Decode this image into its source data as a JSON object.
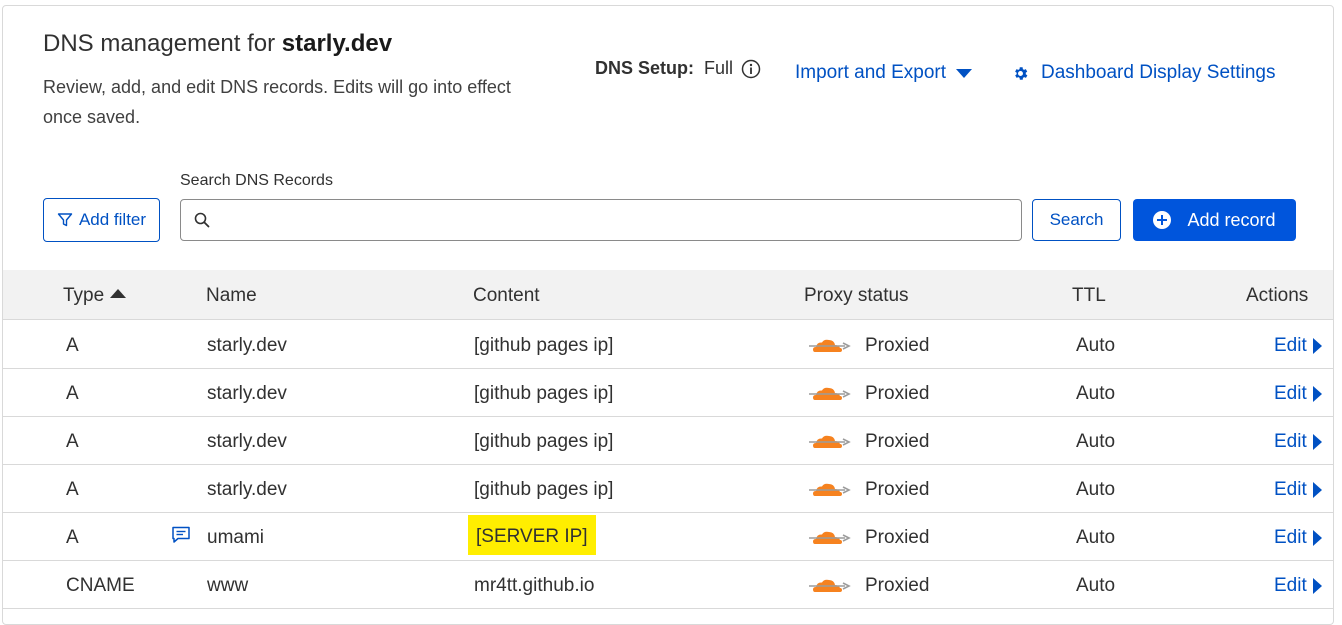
{
  "header": {
    "title_prefix": "DNS management for ",
    "domain": "starly.dev",
    "description": "Review, add, and edit DNS records. Edits will go into effect once saved.",
    "dns_setup_label": "DNS Setup:",
    "dns_setup_value": "Full",
    "import_export": "Import and Export",
    "dashboard_settings": "Dashboard Display Settings"
  },
  "toolbar": {
    "add_filter": "Add filter",
    "search_label": "Search DNS Records",
    "search_value": "",
    "search_button": "Search",
    "add_record": "Add record"
  },
  "table": {
    "columns": [
      "Type",
      "Name",
      "Content",
      "Proxy status",
      "TTL",
      "Actions"
    ],
    "sorted_column": "Type",
    "rows": [
      {
        "type": "A",
        "name": "starly.dev",
        "content": "[github pages ip]",
        "proxy": "Proxied",
        "ttl": "Auto",
        "action": "Edit"
      },
      {
        "type": "A",
        "name": "starly.dev",
        "content": "[github pages ip]",
        "proxy": "Proxied",
        "ttl": "Auto",
        "action": "Edit"
      },
      {
        "type": "A",
        "name": "starly.dev",
        "content": "[github pages ip]",
        "proxy": "Proxied",
        "ttl": "Auto",
        "action": "Edit"
      },
      {
        "type": "A",
        "name": "starly.dev",
        "content": "[github pages ip]",
        "proxy": "Proxied",
        "ttl": "Auto",
        "action": "Edit"
      },
      {
        "type": "A",
        "name": "umami",
        "content": "[SERVER IP]",
        "proxy": "Proxied",
        "ttl": "Auto",
        "action": "Edit",
        "has_comment": true,
        "highlighted": true
      },
      {
        "type": "CNAME",
        "name": "www",
        "content": "mr4tt.github.io",
        "proxy": "Proxied",
        "ttl": "Auto",
        "action": "Edit"
      }
    ]
  },
  "icons": {
    "info": "info-icon",
    "import_caret": "caret-down-icon",
    "gear": "gear-icon",
    "filter": "filter-icon",
    "search": "search-icon",
    "add": "plus-circle-icon",
    "sort": "sort-up-icon",
    "cloud": "cloud-proxied-icon",
    "comment": "comment-icon",
    "edit_caret": "caret-right-icon"
  },
  "colors": {
    "link": "#0051c3",
    "primary_button": "#0055dc",
    "cloud_orange": "#f6821f",
    "highlight": "#ffee00",
    "header_bg": "#f2f2f2"
  }
}
